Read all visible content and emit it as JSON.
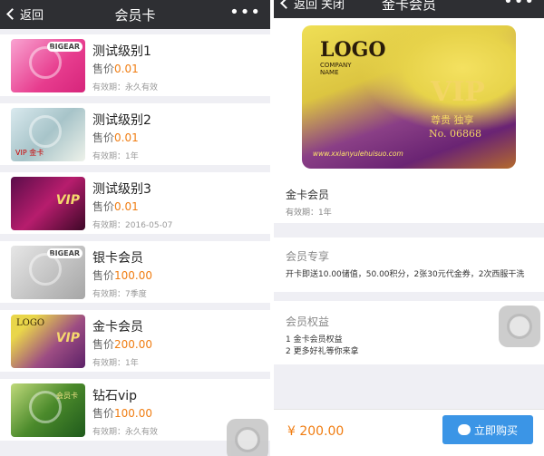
{
  "left": {
    "nav": {
      "back_label": "返回",
      "title": "会员卡",
      "more": "•••"
    },
    "items": [
      {
        "name": "测试级别1",
        "price_label": "售价",
        "price": "0.01",
        "valid_label": "有效期：",
        "valid": "永久有效",
        "badge": "BIGEAR",
        "card_style": "pink"
      },
      {
        "name": "测试级别2",
        "price_label": "售价",
        "price": "0.01",
        "valid_label": "有效期：",
        "valid": "1年",
        "card_text": "VIP 金卡",
        "card_style": "photo"
      },
      {
        "name": "测试级别3",
        "price_label": "售价",
        "price": "0.01",
        "valid_label": "有效期：",
        "valid": "2016-05-07",
        "card_text": "VIP",
        "card_style": "vip3"
      },
      {
        "name": "银卡会员",
        "price_label": "售价",
        "price": "100.00",
        "valid_label": "有效期：",
        "valid": "7季度",
        "badge": "BIGEAR",
        "card_style": "silver"
      },
      {
        "name": "金卡会员",
        "price_label": "售价",
        "price": "200.00",
        "valid_label": "有效期：",
        "valid": "1年",
        "card_text": "VIP",
        "logo": "LOGO",
        "card_style": "gold"
      },
      {
        "name": "钻石vip",
        "price_label": "售价",
        "price": "100.00",
        "valid_label": "有效期：",
        "valid": "永久有效",
        "card_text": "会员卡",
        "card_style": "green"
      }
    ]
  },
  "right": {
    "nav": {
      "back_label": "返回",
      "close_label": "关闭",
      "title": "金卡会员",
      "more": "•••"
    },
    "card": {
      "logo": "LOGO",
      "company_line1": "COMPANY",
      "company_line2": "NAME",
      "vip": "VIP",
      "tagline": "尊贵  独享",
      "number": "No. 06868",
      "url": "www.xxianyulehuisuo.com"
    },
    "info": {
      "name": "金卡会员",
      "valid_label": "有效期：",
      "valid": "1年"
    },
    "privilege": {
      "title": "会员专享",
      "body": "开卡即送10.00储值，50.00积分，2张30元代金券，2次西服干洗"
    },
    "rights": {
      "title": "会员权益",
      "line1": "1 金卡会员权益",
      "line2": "2 更多好礼等你来拿"
    },
    "bottom": {
      "total": "¥ 200.00",
      "buy_label": "立即购买"
    }
  },
  "colors": {
    "navbar": "#2e2f33",
    "price_accent": "#f07d12",
    "buy_button": "#3b95e6",
    "background": "#efeff4"
  }
}
